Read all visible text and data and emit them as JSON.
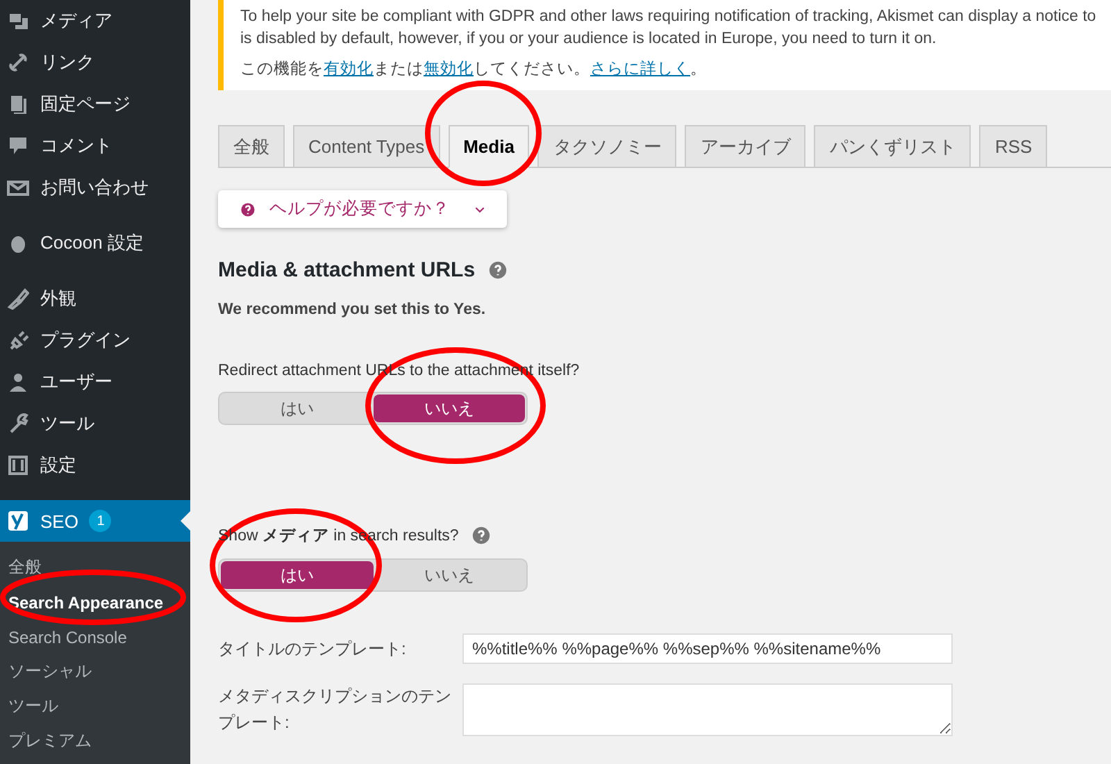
{
  "sidebar": {
    "items": [
      {
        "label": "メディア"
      },
      {
        "label": "リンク"
      },
      {
        "label": "固定ページ"
      },
      {
        "label": "コメント"
      },
      {
        "label": "お問い合わせ"
      },
      {
        "label": "Cocoon 設定"
      },
      {
        "label": "外観"
      },
      {
        "label": "プラグイン"
      },
      {
        "label": "ユーザー"
      },
      {
        "label": "ツール"
      },
      {
        "label": "設定"
      }
    ],
    "seo": {
      "label": "SEO",
      "badge": "1",
      "selected": true
    },
    "submenu": [
      {
        "label": "全般",
        "selected": false
      },
      {
        "label": "Search Appearance",
        "selected": true
      },
      {
        "label": "Search Console",
        "selected": false
      },
      {
        "label": "ソーシャル",
        "selected": false
      },
      {
        "label": "ツール",
        "selected": false
      },
      {
        "label": "プレミアム",
        "selected": false
      }
    ]
  },
  "notice": {
    "lines": [
      "To help your site be compliant with GDPR and other laws requiring notification of tracking, Akismet can display a notice to",
      "is disabled by default, however, if you or your audience is located in Europe, you need to turn it on."
    ],
    "parts": [
      {
        "text": "この機能を",
        "link": false
      },
      {
        "text": "有効化",
        "link": true
      },
      {
        "text": "または",
        "link": false
      },
      {
        "text": "無効化",
        "link": true
      },
      {
        "text": "してください。",
        "link": false
      },
      {
        "text": "さらに詳しく",
        "link": true
      },
      {
        "text": "。",
        "link": false
      }
    ]
  },
  "tabs": [
    {
      "label": "全般",
      "selected": false
    },
    {
      "label": "Content Types",
      "selected": false
    },
    {
      "label": "Media",
      "selected": true
    },
    {
      "label": "タクソノミー",
      "selected": false
    },
    {
      "label": "アーカイブ",
      "selected": false
    },
    {
      "label": "パンくずリスト",
      "selected": false
    },
    {
      "label": "RSS",
      "selected": false
    }
  ],
  "help_button": {
    "label": "ヘルプが必要ですか？"
  },
  "section": {
    "title": "Media & attachment URLs",
    "recommendation": "We recommend you set this to Yes."
  },
  "toggles": [
    {
      "label": "Redirect attachment URLs to the attachment itself?",
      "help": false,
      "options": [
        {
          "label": "はい",
          "selected": false
        },
        {
          "label": "いいえ",
          "selected": true
        }
      ]
    },
    {
      "label": "Show **メディア** in search results?",
      "help": true,
      "options": [
        {
          "label": "はい",
          "selected": true
        },
        {
          "label": "いいえ",
          "selected": false
        }
      ]
    }
  ],
  "fields": [
    {
      "kind": "input",
      "label": "タイトルのテンプレート:",
      "value": "%%title%% %%page%% %%sep%% %%sitename%%"
    },
    {
      "kind": "textarea",
      "label": "メタディスクリプションのテンプレート:"
    }
  ]
}
